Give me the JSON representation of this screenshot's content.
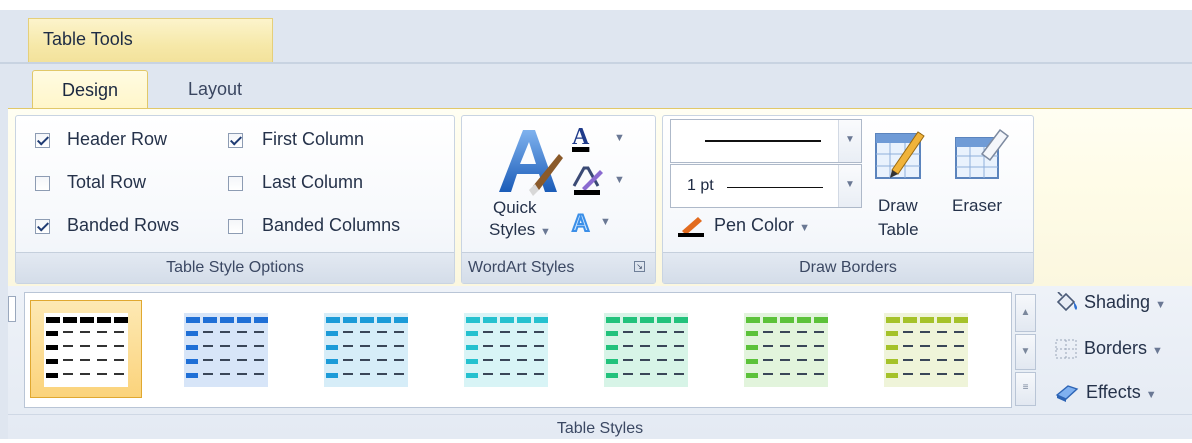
{
  "context_tab": {
    "label": "Table Tools"
  },
  "tabs": [
    {
      "label": "Design",
      "active": true
    },
    {
      "label": "Layout",
      "active": false
    }
  ],
  "table_style_options": {
    "group_label": "Table Style Options",
    "options": [
      {
        "label": "Header Row",
        "checked": true
      },
      {
        "label": "Total Row",
        "checked": false
      },
      {
        "label": "Banded Rows",
        "checked": true
      },
      {
        "label": "First Column",
        "checked": true
      },
      {
        "label": "Last Column",
        "checked": false
      },
      {
        "label": "Banded Columns",
        "checked": false
      }
    ]
  },
  "wordart_styles": {
    "group_label": "WordArt Styles",
    "quick_styles_line1": "Quick",
    "quick_styles_line2": "Styles"
  },
  "draw_borders": {
    "group_label": "Draw Borders",
    "pen_weight": "1 pt",
    "pen_color_label": "Pen Color",
    "draw_table_line1": "Draw",
    "draw_table_line2": "Table",
    "eraser_label": "Eraser"
  },
  "table_styles": {
    "group_label": "Table Styles",
    "styles": [
      {
        "accent": "#000000",
        "selected": true
      },
      {
        "accent": "#1f6fd6",
        "selected": false
      },
      {
        "accent": "#1c9bd8",
        "selected": false
      },
      {
        "accent": "#25c1cf",
        "selected": false
      },
      {
        "accent": "#22c27c",
        "selected": false
      },
      {
        "accent": "#5cc23a",
        "selected": false
      },
      {
        "accent": "#a5c22a",
        "selected": false
      }
    ],
    "shading_label": "Shading",
    "borders_label": "Borders",
    "effects_label": "Effects"
  }
}
